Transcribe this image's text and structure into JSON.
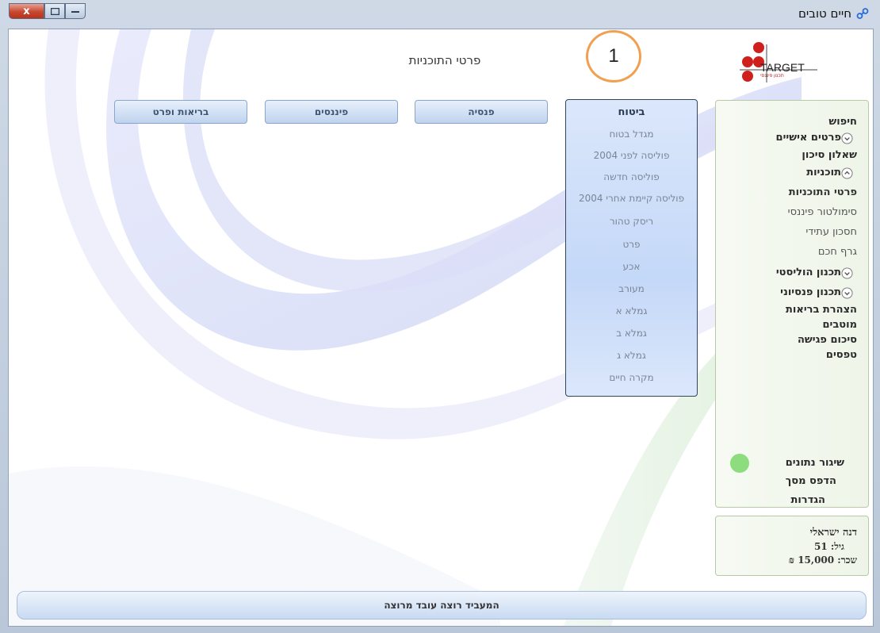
{
  "window": {
    "title": "חיים טובים",
    "close_label": "x"
  },
  "logo": {
    "text": "TARGET",
    "subtitle": "תכנון פיננסי"
  },
  "callout": {
    "number": "1"
  },
  "page": {
    "title": "פרטי התוכניות"
  },
  "tabs": [
    {
      "label": "בריאות ופרט"
    },
    {
      "label": "פיננסים"
    },
    {
      "label": "פנסיה"
    }
  ],
  "insurance": {
    "header": "ביטוח",
    "items": [
      "מגדל בטוח",
      "פוליסה לפני 2004",
      "פוליסה חדשה",
      "פוליסה קיימת אחרי 2004",
      "ריסק טהור",
      "פרט",
      "אכע",
      "מעורב",
      "גמלא א",
      "גמלא ב",
      "גמלא ג",
      "מקרה חיים"
    ]
  },
  "sidebar": {
    "search": "חיפוש",
    "personal": "פרטים אישיים",
    "risk": "שאלון סיכון",
    "plans": "תוכניות",
    "plan_details": "פרטי התוכניות",
    "simulator": "סימולטור פיננסי",
    "future_savings": "חסכון עתידי",
    "smart_graph": "גרף חכם",
    "holistic": "תכנון הוליסטי",
    "pension_planning": "תכנון פנסיוני",
    "health_decl": "הצהרת בריאות",
    "beneficiaries": "מוטבים",
    "meeting_summary": "סיכום פגישה",
    "forms": "טפסים",
    "sync": "שיגור נתונים",
    "print": "הדפס מסך",
    "settings": "הגדרות"
  },
  "user": {
    "name": "דנה ישראלי",
    "age": "גיל: 51",
    "salary": "שכר: 15,000 ₪"
  },
  "status": {
    "message": "המעביד רוצה עובד מרוצה"
  },
  "colors": {
    "accent": "#f0a050",
    "sync": "#8ddc7e",
    "panel": "#c4d8f8"
  }
}
